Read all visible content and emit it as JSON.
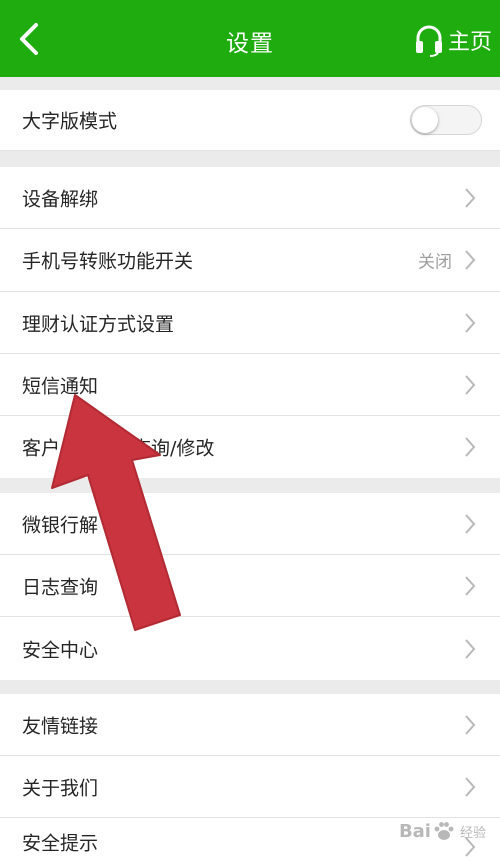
{
  "header": {
    "title": "设置",
    "home_label": "主页",
    "back_icon": "chevron-left-icon",
    "headset_icon": "headset-icon",
    "background_color": "#1fac0f"
  },
  "settings": {
    "large_font": {
      "label": "大字版模式",
      "toggle_on": false
    },
    "device_unbind": {
      "label": "设备解绑"
    },
    "phone_transfer": {
      "label": "手机号转账功能开关",
      "value": "关闭"
    },
    "finance_auth": {
      "label": "理财认证方式设置"
    },
    "sms_notice": {
      "label": "短信通知"
    },
    "customer_info": {
      "label_start": "客户",
      "label_end": "查询/修改"
    },
    "wechat_bank": {
      "label": "微银行解"
    },
    "log_query": {
      "label": "日志查询"
    },
    "security_center": {
      "label": "安全中心"
    },
    "friend_links": {
      "label": "友情链接"
    },
    "about_us": {
      "label": "关于我们"
    },
    "security_tips": {
      "label": "安全提示"
    }
  },
  "annotation": {
    "arrow_color": "#c9343e"
  },
  "watermark": {
    "text": "Bai",
    "text_after": "经验"
  }
}
